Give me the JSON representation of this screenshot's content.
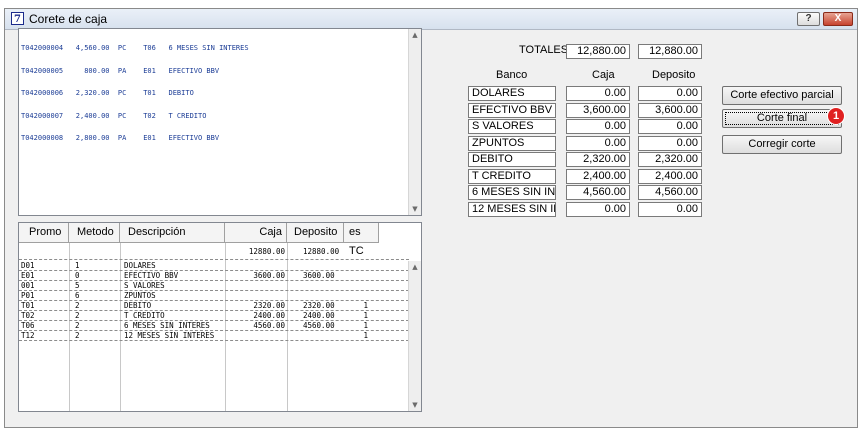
{
  "window": {
    "title": "Corete de caja",
    "icon_letter": "7",
    "help_label": "?",
    "close_label": "X"
  },
  "log_lines": [
    "T042000004   4,560.00  PC    T06   6 MESES SIN INTERES",
    "T042000005     800.00  PA    E01   EFECTIVO BBV",
    "T042000006   2,320.00  PC    T01   DEBITO",
    "T042000007   2,400.00  PC    T02   T CREDITO",
    "T042000008   2,800.00  PA    E01   EFECTIVO BBV"
  ],
  "grid": {
    "headers": [
      "Promo",
      "Metodo",
      "Descripción",
      "Caja",
      "Deposito",
      "es TC"
    ],
    "totals": {
      "caja": "12880.00",
      "deposito": "12880.00"
    },
    "rows": [
      {
        "promo": "D01",
        "metodo": "1",
        "descripcion": "DOLARES",
        "caja": "",
        "deposito": "",
        "es_tc": ""
      },
      {
        "promo": "E01",
        "metodo": "0",
        "descripcion": "EFECTIVO BBV",
        "caja": "3600.00",
        "deposito": "3600.00",
        "es_tc": ""
      },
      {
        "promo": "001",
        "metodo": "5",
        "descripcion": "S VALORES",
        "caja": "",
        "deposito": "",
        "es_tc": ""
      },
      {
        "promo": "P01",
        "metodo": "6",
        "descripcion": "ZPUNTOS",
        "caja": "",
        "deposito": "",
        "es_tc": ""
      },
      {
        "promo": "T01",
        "metodo": "2",
        "descripcion": "DEBITO",
        "caja": "2320.00",
        "deposito": "2320.00",
        "es_tc": "1"
      },
      {
        "promo": "T02",
        "metodo": "2",
        "descripcion": "T CREDITO",
        "caja": "2400.00",
        "deposito": "2400.00",
        "es_tc": "1"
      },
      {
        "promo": "T06",
        "metodo": "2",
        "descripcion": "6 MESES SIN INTERES",
        "caja": "4560.00",
        "deposito": "4560.00",
        "es_tc": "1"
      },
      {
        "promo": "T12",
        "metodo": "2",
        "descripcion": "12 MESES SIN INTERES",
        "caja": "",
        "deposito": "",
        "es_tc": "1"
      }
    ]
  },
  "summary": {
    "totales_label": "TOTALES",
    "totales_caja": "12,880.00",
    "totales_deposito": "12,880.00",
    "col_banco": "Banco",
    "col_caja": "Caja",
    "col_deposito": "Deposito",
    "rows": [
      {
        "banco": "DOLARES",
        "caja": "0.00",
        "deposito": "0.00"
      },
      {
        "banco": "EFECTIVO BBV",
        "caja": "3,600.00",
        "deposito": "3,600.00"
      },
      {
        "banco": "S VALORES",
        "caja": "0.00",
        "deposito": "0.00"
      },
      {
        "banco": "ZPUNTOS",
        "caja": "0.00",
        "deposito": "0.00"
      },
      {
        "banco": "DEBITO",
        "caja": "2,320.00",
        "deposito": "2,320.00"
      },
      {
        "banco": "T CREDITO",
        "caja": "2,400.00",
        "deposito": "2,400.00"
      },
      {
        "banco": "6 MESES SIN INTERE",
        "caja": "4,560.00",
        "deposito": "4,560.00"
      },
      {
        "banco": "12 MESES SIN INTEF",
        "caja": "0.00",
        "deposito": "0.00"
      }
    ]
  },
  "buttons": {
    "corte_parcial": "Corte efectivo parcial",
    "corte_final": "Corte final",
    "corregir": "Corregir corte"
  },
  "badge": "1"
}
